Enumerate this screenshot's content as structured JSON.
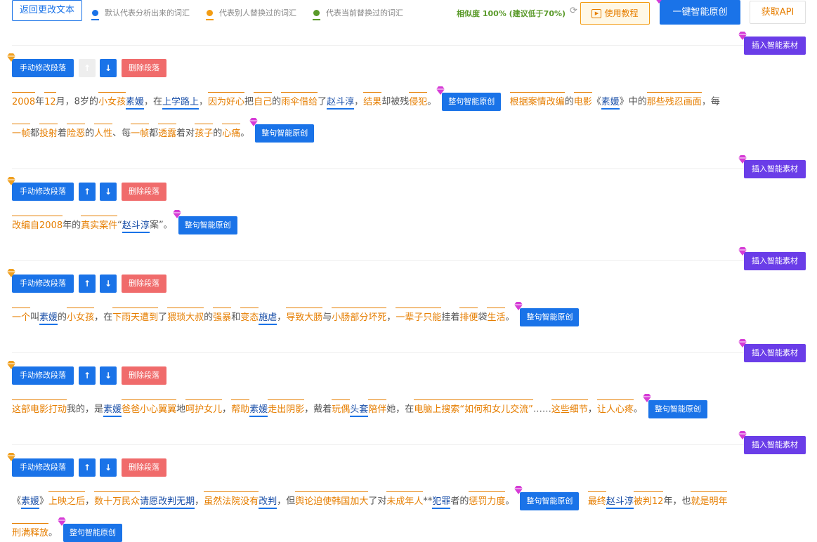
{
  "toolbar": {
    "back_label": "返回更改文本",
    "legend": [
      {
        "label": "默认代表分析出来的词汇",
        "color": "#1a73e8"
      },
      {
        "label": "代表别人替换过的词汇",
        "color": "#f39c12"
      },
      {
        "label": "代表当前替换过的词汇",
        "color": "#5a9a2a"
      }
    ],
    "similarity": "相似度 100% (建议低于70%)",
    "tutorial_label": "使用教程",
    "oneclick_label": "一键智能原创",
    "api_label": "获取API"
  },
  "controls": {
    "insert_label": "插入智能素材",
    "manual_label": "手动修改段落",
    "up_label": "↑",
    "down_label": "↓",
    "delete_label": "删除段落",
    "whole_label": "整句智能原创"
  },
  "colors": {
    "primary": "#1a73e8",
    "purple": "#6a3de8",
    "danger": "#f06b6b",
    "orange": "#e67e00",
    "green": "#5a9a2a"
  }
}
